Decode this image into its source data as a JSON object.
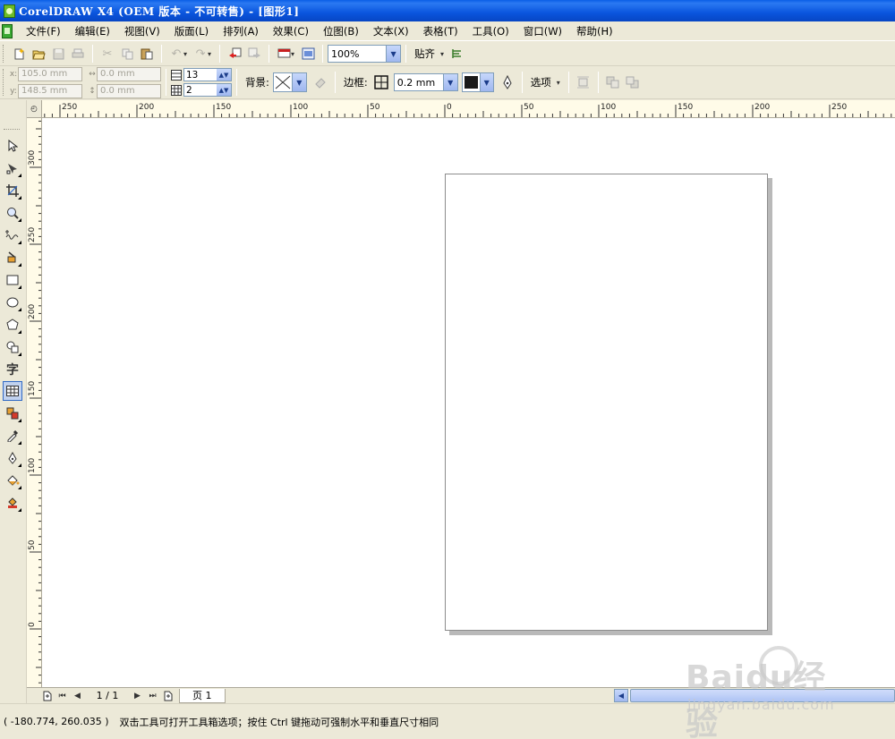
{
  "window": {
    "title": "CorelDRAW X4 (OEM 版本 - 不可转售) - [图形1]"
  },
  "menu": {
    "items": [
      "文件(F)",
      "编辑(E)",
      "视图(V)",
      "版面(L)",
      "排列(A)",
      "效果(C)",
      "位图(B)",
      "文本(X)",
      "表格(T)",
      "工具(O)",
      "窗口(W)",
      "帮助(H)"
    ]
  },
  "toolbar": {
    "zoom_value": "100%",
    "snap_label": "贴齐"
  },
  "property_bar": {
    "x_label": "x:",
    "x_value": "105.0 mm",
    "y_label": "y:",
    "y_value": "148.5 mm",
    "w_value": "0.0 mm",
    "h_value": "0.0 mm",
    "rows_value": "13",
    "cols_value": "2",
    "background_label": "背景:",
    "border_label": "边框:",
    "border_width_value": "0.2 mm",
    "options_label": "选项",
    "border_color": "#1a1a1a"
  },
  "ruler": {
    "corner_label": "◴",
    "horizontal_labels": [
      "250",
      "200",
      "150",
      "100",
      "50",
      "0",
      "50",
      "100",
      "150",
      "200",
      "250"
    ],
    "vertical_labels": [
      "300",
      "250",
      "200",
      "150",
      "100",
      "50",
      "0"
    ]
  },
  "toolbox": {
    "text_tool_glyph": "字"
  },
  "page_nav": {
    "count": "1 / 1",
    "tab_label": "页 1"
  },
  "status": {
    "coords": "( -180.774, 260.035 )",
    "hint": "双击工具可打开工具箱选项；按住 Ctrl 键拖动可强制水平和垂直尺寸相同"
  },
  "watermark": {
    "main": "Baidu经验",
    "sub": "jingyan.baidu.com"
  }
}
